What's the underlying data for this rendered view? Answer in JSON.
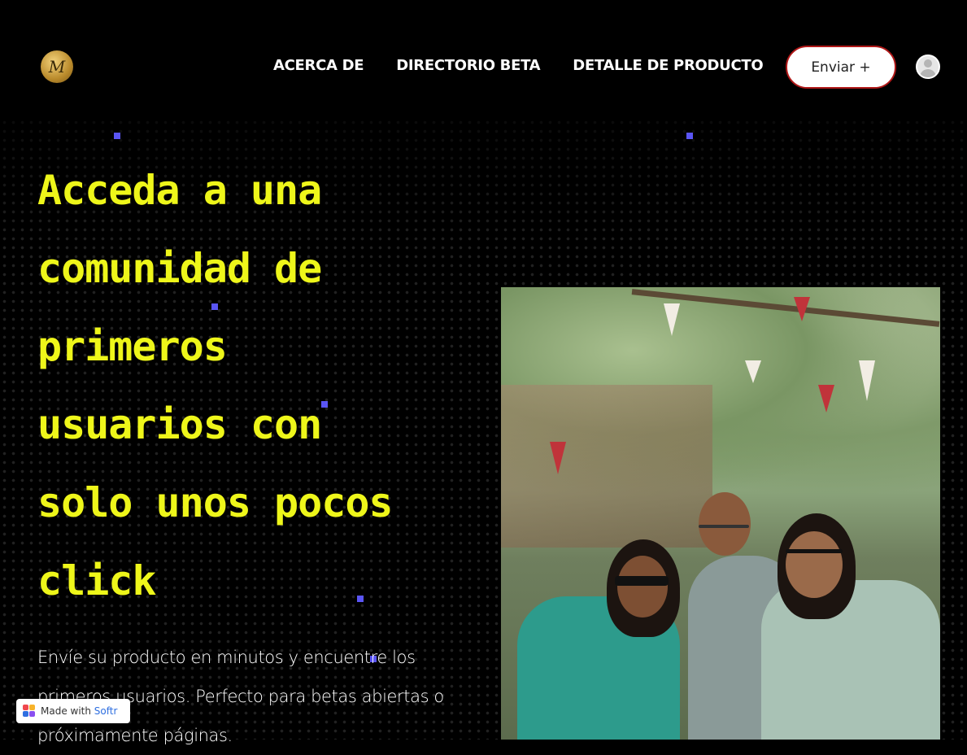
{
  "header": {
    "logo_text": "M",
    "nav": [
      "ACERCA DE",
      "DIRECTORIO BETA",
      "DETALLE DE PRODUCTO"
    ],
    "cta_label": "Enviar +"
  },
  "hero": {
    "title_lines": [
      "Acceda a una",
      "comunidad de",
      "primeros",
      "usuarios con",
      "solo unos pocos",
      "click"
    ],
    "subtitle_lines": [
      "Envíe su producto en minutos y encuentre los",
      "primeros usuarios. Perfecto para betas abiertas o",
      "próximamente páginas."
    ]
  },
  "badge": {
    "prefix": "Made with ",
    "brand": "Softr"
  },
  "colors": {
    "title": "#eef61a",
    "accent": "#5a55f5",
    "cta_border": "#b01818",
    "brand": "#2f6fe0"
  },
  "icons": {
    "avatar": "user-avatar-icon",
    "badge": "softr-logo-icon"
  }
}
